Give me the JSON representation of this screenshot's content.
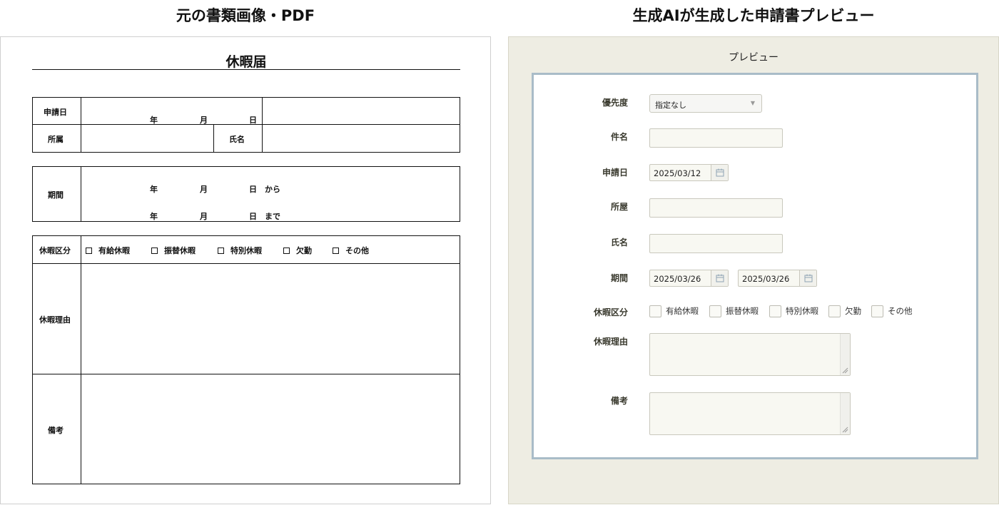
{
  "headings": {
    "left": "元の書類画像・PDF",
    "right": "生成AIが生成した申請書プレビュー"
  },
  "paper": {
    "title": "休暇届",
    "labels": {
      "apply_date": "申請日",
      "affiliation": "所属",
      "name": "氏名",
      "period": "期間",
      "leave_type": "休暇区分",
      "reason": "休暇理由",
      "remarks": "備考"
    },
    "date_units": {
      "year": "年",
      "month": "月",
      "day": "日"
    },
    "period_suffix": {
      "from": "から",
      "to": "まで"
    },
    "leave_options": [
      "有給休暇",
      "振替休暇",
      "特別休暇",
      "欠勤",
      "その他"
    ]
  },
  "preview": {
    "title": "プレビュー",
    "fields": {
      "priority": {
        "label": "優先度",
        "value": "指定なし"
      },
      "subject": {
        "label": "件名",
        "value": ""
      },
      "apply_date": {
        "label": "申請日",
        "value": "2025/03/12"
      },
      "affiliation": {
        "label": "所屋",
        "value": ""
      },
      "name": {
        "label": "氏名",
        "value": ""
      },
      "period": {
        "label": "期間",
        "start": "2025/03/26",
        "end": "2025/03/26"
      },
      "leave_type": {
        "label": "休暇区分",
        "options": [
          "有給休暇",
          "振替休暇",
          "特別休暇",
          "欠勤",
          "その他"
        ]
      },
      "reason": {
        "label": "休暇理由",
        "value": ""
      },
      "remarks": {
        "label": "備考",
        "value": ""
      }
    }
  },
  "icons": {
    "calendar": "calendar-icon",
    "dropdown": "chevron-down-icon",
    "resize": "resize-grip-icon"
  },
  "colors": {
    "preview_bg": "#eeede3",
    "panel_border": "#a9bcc8",
    "label": "#3a3a2e"
  }
}
